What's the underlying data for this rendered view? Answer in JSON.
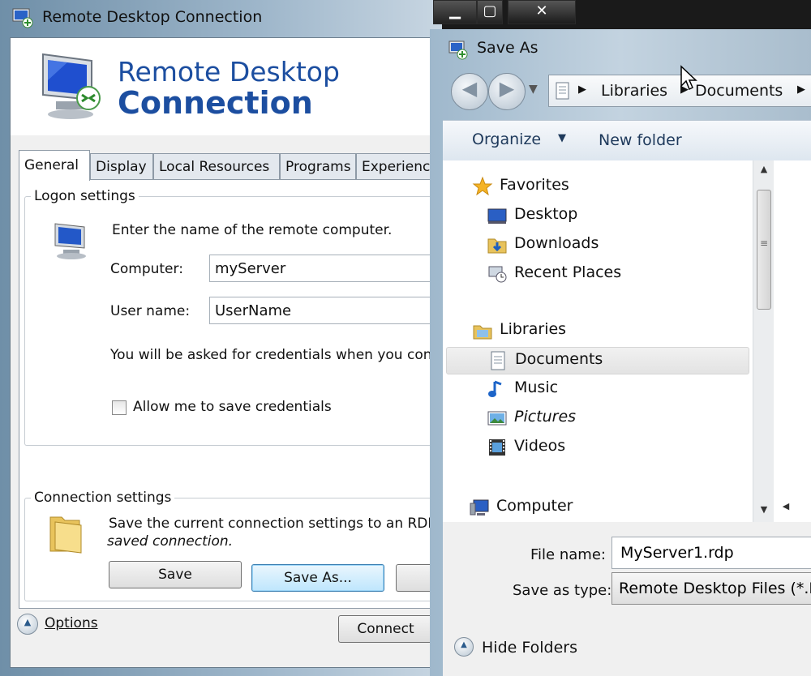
{
  "rdc": {
    "title": "Remote Desktop Connection",
    "banner_line1": "Remote Desktop",
    "banner_line2": "Connection",
    "tabs": [
      {
        "label": "General"
      },
      {
        "label": "Display"
      },
      {
        "label": "Local Resources"
      },
      {
        "label": "Programs"
      },
      {
        "label": "Experience"
      }
    ],
    "logon": {
      "group_label": "Logon settings",
      "prompt": "Enter the name of the remote computer.",
      "computer_label": "Computer:",
      "computer_value": "myServer",
      "username_label": "User name:",
      "username_value": "UserName",
      "credentials_note": "You will be asked for credentials when you conne",
      "allow_save_label": "Allow me to save credentials"
    },
    "connection": {
      "group_label": "Connection settings",
      "line1": "Save the current connection settings to an RDP fi",
      "line2": "saved connection.",
      "save_label": "Save",
      "save_as_label": "Save As..."
    },
    "options_label": "Options",
    "connect_label": "Connect"
  },
  "saveas": {
    "title": "Save As",
    "breadcrumb": [
      "Libraries",
      "Documents"
    ],
    "toolbar": {
      "organize": "Organize",
      "new_folder": "New folder"
    },
    "nav": {
      "favorites": "Favorites",
      "desktop": "Desktop",
      "downloads": "Downloads",
      "recent": "Recent Places",
      "libraries": "Libraries",
      "documents": "Documents",
      "music": "Music",
      "pictures": "Pictures",
      "videos": "Videos",
      "computer": "Computer"
    },
    "file_name_label": "File name:",
    "file_name_value": "MyServer1.rdp",
    "save_type_label": "Save as type:",
    "save_type_value": "Remote Desktop Files (*.R",
    "hide_folders": "Hide Folders"
  },
  "colors": {
    "brand_blue": "#1c4ea0",
    "selection": "#e3e3e3"
  }
}
